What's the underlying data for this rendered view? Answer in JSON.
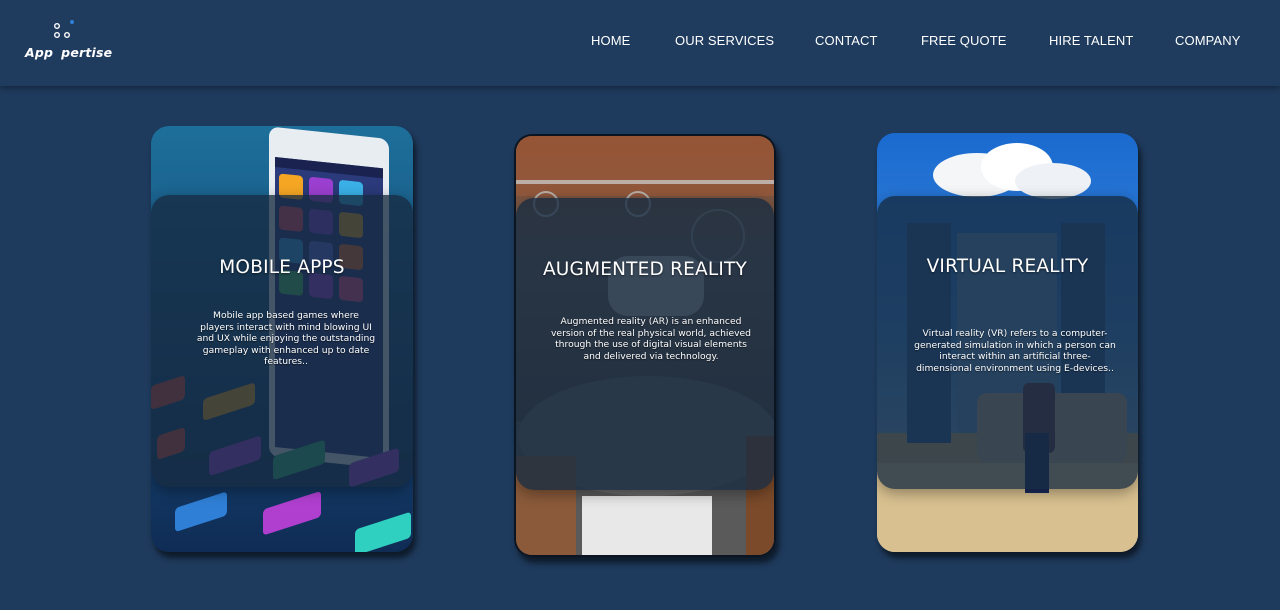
{
  "brand": {
    "logo_text_left": "App",
    "logo_text_right": "pertise"
  },
  "nav": {
    "items": [
      {
        "label": "HOME"
      },
      {
        "label": "OUR SERVICES"
      },
      {
        "label": "CONTACT"
      },
      {
        "label": "FREE QUOTE"
      },
      {
        "label": "HIRE TALENT"
      },
      {
        "label": "COMPANY"
      }
    ]
  },
  "cards": [
    {
      "title": "MOBILE APPS",
      "description": "Mobile app based games where players interact with mind blowing UI and UX while enjoying the outstanding gameplay with enhanced up to date features..",
      "image": "phone-with-app-icons"
    },
    {
      "title": "AUGMENTED REALITY",
      "description": "Augmented reality (AR) is an enhanced version of the real physical world, achieved through the use of digital visual elements and delivered via technology.",
      "image": "person-with-vr-headset"
    },
    {
      "title": "VIRTUAL REALITY",
      "description": "Virtual reality (VR) refers to a computer-generated simulation in which a person can interact within an artificial three-dimensional environment using E-devices..",
      "image": "person-on-sofa-in-desert-with-door"
    }
  ],
  "colors": {
    "background": "#1e3a5c",
    "navbar": "#1f3b5e",
    "overlay": "#162a40",
    "logo_accent": "#2f7fd6"
  }
}
